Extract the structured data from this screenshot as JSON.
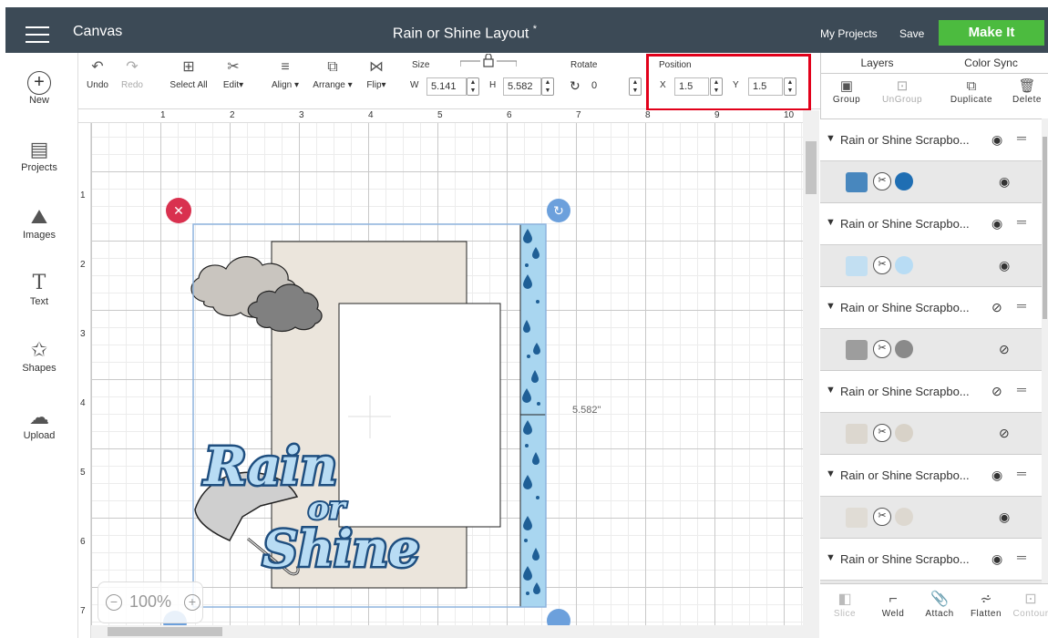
{
  "header": {
    "app_name": "Canvas",
    "doc_title": "Rain or Shine Layout",
    "unsaved_marker": "*",
    "my_projects": "My Projects",
    "save": "Save",
    "make_it": "Make It",
    "make_it_color": "#4cbb3f"
  },
  "toolbar": {
    "undo": "Undo",
    "redo": "Redo",
    "select_all": "Select All",
    "edit": "Edit",
    "align": "Align",
    "arrange": "Arrange",
    "flip": "Flip",
    "size_label": "Size",
    "w_label": "W",
    "w_value": "5.141",
    "h_label": "H",
    "h_value": "5.582",
    "rotate_label": "Rotate",
    "rotate_value": "0",
    "position_label": "Position",
    "x_label": "X",
    "x_value": "1.5",
    "y_label": "Y",
    "y_value": "1.5"
  },
  "sidebar": {
    "items": [
      {
        "label": "New",
        "icon": "plus-circle-icon"
      },
      {
        "label": "Projects",
        "icon": "projects-icon"
      },
      {
        "label": "Images",
        "icon": "images-icon"
      },
      {
        "label": "Text",
        "icon": "text-icon"
      },
      {
        "label": "Shapes",
        "icon": "shapes-icon"
      },
      {
        "label": "Upload",
        "icon": "upload-cloud-icon"
      }
    ]
  },
  "ruler": {
    "top": [
      "1",
      "2",
      "3",
      "4",
      "5",
      "6",
      "7",
      "8",
      "9",
      "10"
    ],
    "left": [
      "1",
      "2",
      "3",
      "4",
      "5",
      "6",
      "7"
    ]
  },
  "canvas": {
    "height_dim": "5.582\"",
    "zoom": "100%",
    "title_art_line1": "Rain",
    "title_art_line2": "or",
    "title_art_line3": "Shine"
  },
  "layers_panel": {
    "tab_layers": "Layers",
    "tab_color_sync": "Color Sync",
    "group": "Group",
    "ungroup": "UnGroup",
    "duplicate": "Duplicate",
    "delete": "Delete",
    "groups": [
      {
        "name": "Rain or Shine Scrapbo...",
        "visible": true,
        "layer_color": "#1f6eb3"
      },
      {
        "name": "Rain or Shine Scrapbo...",
        "visible": true,
        "layer_color": "#b8dcf4"
      },
      {
        "name": "Rain or Shine Scrapbo...",
        "visible": false,
        "layer_color": "#8a8a8a"
      },
      {
        "name": "Rain or Shine Scrapbo...",
        "visible": false,
        "layer_color": "#d8d2c8"
      },
      {
        "name": "Rain or Shine Scrapbo...",
        "visible": true,
        "layer_color": "#ddd8d0"
      },
      {
        "name": "Rain or Shine Scrapbo...",
        "visible": true,
        "layer_color": "#cfcfcf"
      }
    ]
  },
  "bottom_tools": {
    "slice": "Slice",
    "weld": "Weld",
    "attach": "Attach",
    "flatten": "Flatten",
    "contour": "Contour"
  },
  "colors": {
    "header_bg": "#3c4a56",
    "highlight": "#e2001a",
    "rain_strip": "#a9d6f0",
    "rain_drop": "#1f5f96",
    "mat": "#ebe5dc",
    "cloud_light": "#c9c5bf",
    "cloud_dark": "#808080"
  }
}
